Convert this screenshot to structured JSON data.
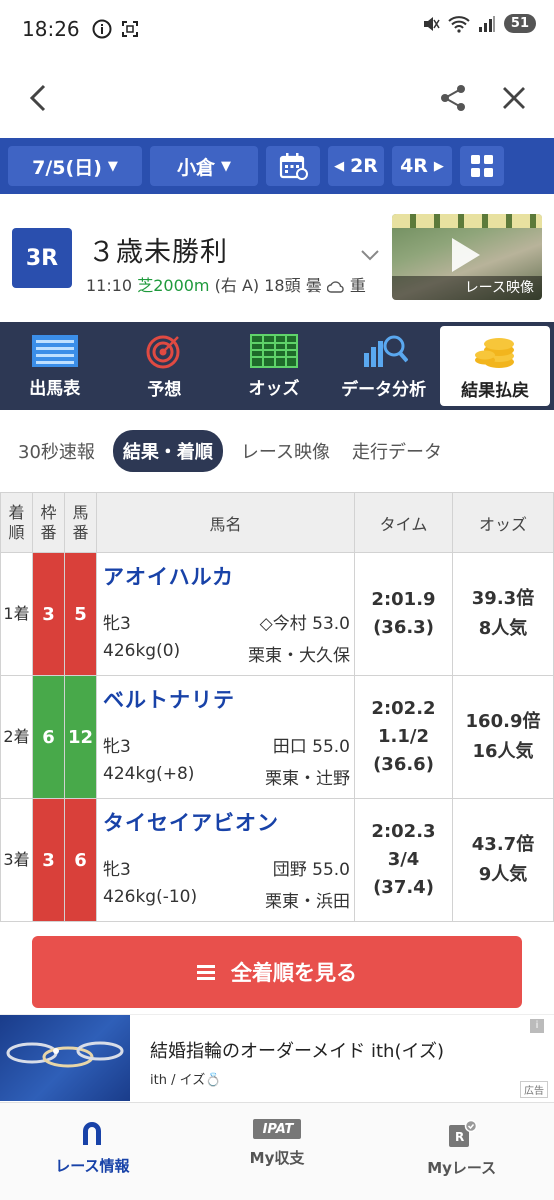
{
  "status_bar": {
    "time": "18:26",
    "battery": "51"
  },
  "selector": {
    "date": "7/5(日)",
    "venue": "小倉",
    "prev_race": "2R",
    "next_race": "4R"
  },
  "race": {
    "number": "3R",
    "name": "３歳未勝利",
    "start_time": "11:10",
    "surface_distance": "芝2000m",
    "direction": "(右 A)",
    "runners": "18頭",
    "weather": "曇",
    "track_condition": "重",
    "video_label": "レース映像"
  },
  "menu": [
    {
      "label": "出馬表",
      "icon": "race-card-icon"
    },
    {
      "label": "予想",
      "icon": "target-icon"
    },
    {
      "label": "オッズ",
      "icon": "odds-table-icon"
    },
    {
      "label": "データ分析",
      "icon": "data-analysis-icon"
    },
    {
      "label": "結果払戻",
      "icon": "coins-icon"
    }
  ],
  "sub_tabs": [
    "30秒速報",
    "結果・着順",
    "レース映像",
    "走行データ"
  ],
  "table": {
    "headers": {
      "rank": "着順",
      "waku": "枠番",
      "uma": "馬番",
      "name": "馬名",
      "time": "タイム",
      "odds": "オッズ"
    },
    "rows": [
      {
        "rank": "1着",
        "waku": "3",
        "uma": "5",
        "name": "アオイハルカ",
        "sex_age": "牝3",
        "jockey": "◇今村 53.0",
        "weight": "426kg(0)",
        "trainer": "栗東・大久保",
        "time": "2:01.9",
        "margin": "",
        "last3f": "(36.3)",
        "odds": "39.3倍",
        "popularity": "8人気",
        "color": "#d9403a"
      },
      {
        "rank": "2着",
        "waku": "6",
        "uma": "12",
        "name": "ベルトナリテ",
        "sex_age": "牝3",
        "jockey": "田口 55.0",
        "weight": "424kg(+8)",
        "trainer": "栗東・辻野",
        "time": "2:02.2",
        "margin": "1.1/2",
        "last3f": "(36.6)",
        "odds": "160.9倍",
        "popularity": "16人気",
        "color": "#48a94a"
      },
      {
        "rank": "3着",
        "waku": "3",
        "uma": "6",
        "name": "タイセイアビオン",
        "sex_age": "牝3",
        "jockey": "団野 55.0",
        "weight": "426kg(-10)",
        "trainer": "栗東・浜田",
        "time": "2:02.3",
        "margin": "3/4",
        "last3f": "(37.4)",
        "odds": "43.7倍",
        "popularity": "9人気",
        "color": "#d9403a"
      }
    ]
  },
  "full_results_label": "全着順を見る",
  "ad": {
    "title": "結婚指輪のオーダーメイド ith(イズ)",
    "brand": "ith / イズ💍",
    "tag": "広告"
  },
  "bottom_nav": [
    {
      "label": "レース情報",
      "icon": "horseshoe-icon"
    },
    {
      "label": "My収支",
      "icon": "ipat-icon",
      "badge": "IPAT"
    },
    {
      "label": "Myレース",
      "icon": "my-race-icon"
    }
  ]
}
